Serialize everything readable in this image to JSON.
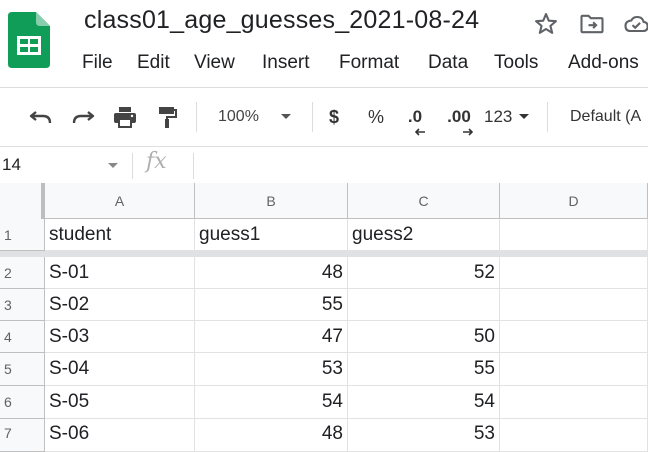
{
  "app": {
    "title": "class01_age_guesses_2021-08-24",
    "brand_color": "#0f9d58",
    "header_icons": [
      "star-icon",
      "move-to-folder-icon",
      "cloud-status-icon"
    ]
  },
  "menu": [
    "File",
    "Edit",
    "View",
    "Insert",
    "Format",
    "Data",
    "Tools",
    "Add-ons"
  ],
  "toolbar": {
    "zoom": "100%",
    "currency": "$",
    "percent": "%",
    "decrease_decimal": ".0",
    "increase_decimal": ".00",
    "more_formats": "123",
    "font": "Default (A"
  },
  "formula_bar": {
    "cell_ref": "14",
    "fx": "fx",
    "value": ""
  },
  "grid": {
    "columns": [
      "A",
      "B",
      "C",
      "D"
    ],
    "rows": [
      {
        "num": "1",
        "cells": [
          "student",
          "guess1",
          "guess2",
          ""
        ]
      },
      {
        "num": "2",
        "cells": [
          "S-01",
          "48",
          "52",
          ""
        ]
      },
      {
        "num": "3",
        "cells": [
          "S-02",
          "55",
          "",
          ""
        ]
      },
      {
        "num": "4",
        "cells": [
          "S-03",
          "47",
          "50",
          ""
        ]
      },
      {
        "num": "5",
        "cells": [
          "S-04",
          "53",
          "55",
          ""
        ]
      },
      {
        "num": "6",
        "cells": [
          "S-05",
          "54",
          "54",
          ""
        ]
      },
      {
        "num": "7",
        "cells": [
          "S-06",
          "48",
          "53",
          ""
        ]
      }
    ]
  }
}
